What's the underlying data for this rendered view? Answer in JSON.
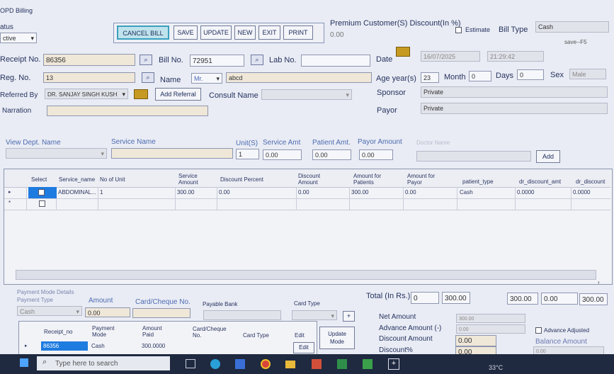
{
  "window": {
    "title": "OPD Billing"
  },
  "header": {
    "status_label": "atus",
    "status_value": "ctive",
    "buttons": {
      "cancel_bill": "CANCEL BILL",
      "save": "SAVE",
      "update": "UPDATE",
      "new": "NEW",
      "exit": "EXIT",
      "print": "PRINT"
    },
    "premium_label": "Premium Customer(S) Discount(In %)",
    "premium_value": "0.00",
    "estimate_label": "Estimate",
    "bill_type_label": "Bill Type",
    "bill_type_value": "Cash",
    "save_hint": "save--F5"
  },
  "form": {
    "receipt_no_label": "Receipt No.",
    "receipt_no_value": "86356",
    "bill_no_label": "Bill No.",
    "bill_no_value": "72951",
    "lab_no_label": "Lab No.",
    "lab_no_value": "",
    "date_label": "Date",
    "date_value": "16/07/2025",
    "time_value": "21:29:42",
    "reg_no_label": "Reg. No.",
    "reg_no_value": "13",
    "name_label": "Name",
    "title_value": "Mr.",
    "name_value": "abcd",
    "age_label": "Age year(s)",
    "age_value": "23",
    "month_label": "Month",
    "month_value": "0",
    "days_label": "Days",
    "days_value": "0",
    "sex_label": "Sex",
    "sex_value": "Male",
    "referred_by_label": "Referred By",
    "referred_by_value": "DR. SANJAY SINGH KUSH",
    "add_referral": "Add Referral",
    "consult_name_label": "Consult Name",
    "consult_name_value": "",
    "sponsor_label": "Sponsor",
    "sponsor_value": "Private",
    "narration_label": "Narration",
    "narration_value": "",
    "payor_label": "Payor",
    "payor_value": "Private"
  },
  "service_entry": {
    "dept_label": "View Dept. Name",
    "service_label": "Service Name",
    "units_label": "Unit(S)",
    "units_value": "1",
    "service_amt_label": "Service Amt",
    "service_amt_value": "0.00",
    "patient_amt_label": "Patient Amt.",
    "patient_amt_value": "0.00",
    "payor_amt_label": "Payor Amount",
    "payor_amt_value": "0.00",
    "doctor_label": "Doctor Name",
    "add_button": "Add"
  },
  "grid": {
    "columns": [
      "Select",
      "Service_name",
      "No of Unit",
      "Service Amount",
      "Discount Percent",
      "Discount Amount",
      "Amount for Patients",
      "Amount for Payor",
      "patient_type",
      "dr_discount_amt",
      "dr_discount"
    ],
    "rows": [
      [
        "",
        "ABDOMINAL...",
        "1",
        "300.00",
        "0.00",
        "0.00",
        "300.00",
        "0.00",
        "Cash",
        "0.0000",
        "0.0000"
      ]
    ]
  },
  "totals": {
    "total_label": "Total (In Rs.)",
    "total_values": [
      "0",
      "300.00",
      "300.00",
      "0.00",
      "300.00"
    ],
    "net_amount_label": "Net Amount",
    "net_amount_value": "300.00",
    "advance_label": "Advance Amount (-)",
    "advance_value": "0.00",
    "discount_amount_label": "Discount Amount",
    "discount_amount_value": "0.00",
    "discount_pct_label": "Discount%",
    "discount_pct_value": "0.00",
    "advance_adjusted_label": "Advance Adjusted",
    "balance_label": "Balance Amount",
    "balance_value": "0.00"
  },
  "payment": {
    "section_title": "Payment Mode Details",
    "payment_type_label": "Payment Type",
    "payment_type_value": "Cash",
    "amount_label": "Amount",
    "amount_value": "0.00",
    "card_no_label": "Card/Cheque No.",
    "bank_label": "Payable Bank",
    "card_type_label": "Card Type",
    "columns": [
      "Receipt_no",
      "Payment Mode",
      "Amount Paid",
      "Card/Cheque No.",
      "Card Type",
      "Edit"
    ],
    "row": [
      "86356",
      "Cash",
      "300.0000",
      "",
      "",
      "Edit"
    ],
    "update_mode": "Update Mode"
  },
  "taskbar": {
    "search_placeholder": "Type here to search",
    "temp": "33°C"
  }
}
